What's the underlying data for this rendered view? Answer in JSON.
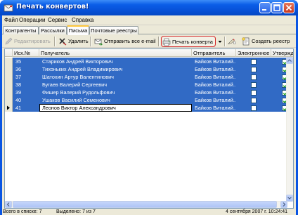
{
  "window": {
    "title": "Печать конвертов!"
  },
  "menu": [
    "Файл",
    "Операции",
    "Сервис",
    "Справка"
  ],
  "tabs": [
    "Контрагенты",
    "Рассылки",
    "Письма",
    "Почтовые реестры"
  ],
  "active_tab": "Письма",
  "toolbar": {
    "edit_label": "Редактировать",
    "delete_label": "Удалить",
    "send_all_label": "Отправить все e-mail",
    "print_envelope_label": "Печать конверта",
    "create_register_label": "Создать реестр"
  },
  "grid": {
    "columns": [
      "Исх.№",
      "Получатель",
      "Отправитель",
      "Электронное",
      "Утвержде"
    ],
    "rows": [
      {
        "num": "35",
        "recipient": "Стариков Андрей Викторович",
        "sender": "Байков Виталий...",
        "electronic": false,
        "approved": true,
        "selected": true
      },
      {
        "num": "36",
        "recipient": "Тихоньких Андрей Владимирович",
        "sender": "Байков Виталий...",
        "electronic": false,
        "approved": true,
        "selected": true
      },
      {
        "num": "37",
        "recipient": "Шатохин Артур Валентинович",
        "sender": "Байков Виталий...",
        "electronic": false,
        "approved": true,
        "selected": true
      },
      {
        "num": "38",
        "recipient": "Бугаев Валерий Сергеевич",
        "sender": "Байков Виталий...",
        "electronic": false,
        "approved": true,
        "selected": true
      },
      {
        "num": "39",
        "recipient": "Фишер Валерий Рудольфович",
        "sender": "Байков Виталий...",
        "electronic": false,
        "approved": true,
        "selected": true
      },
      {
        "num": "40",
        "recipient": "Ушаков Василий Семенович",
        "sender": "Байков Виталий...",
        "electronic": false,
        "approved": true,
        "selected": true
      },
      {
        "num": "41",
        "recipient": "Леонов Виктор Александрович",
        "sender": "Байков Виталий...",
        "electronic": false,
        "approved": true,
        "selected": true,
        "editing": true
      }
    ]
  },
  "status": {
    "total": "Всего в списке: 7",
    "selected": "Выделено: 7 из 7",
    "datetime": "4 сентября 2007 г. 10:24:41"
  },
  "colors": {
    "selection": "#316ac5",
    "titlebar": "#0650d6",
    "print_button_border": "#d42a2a"
  }
}
